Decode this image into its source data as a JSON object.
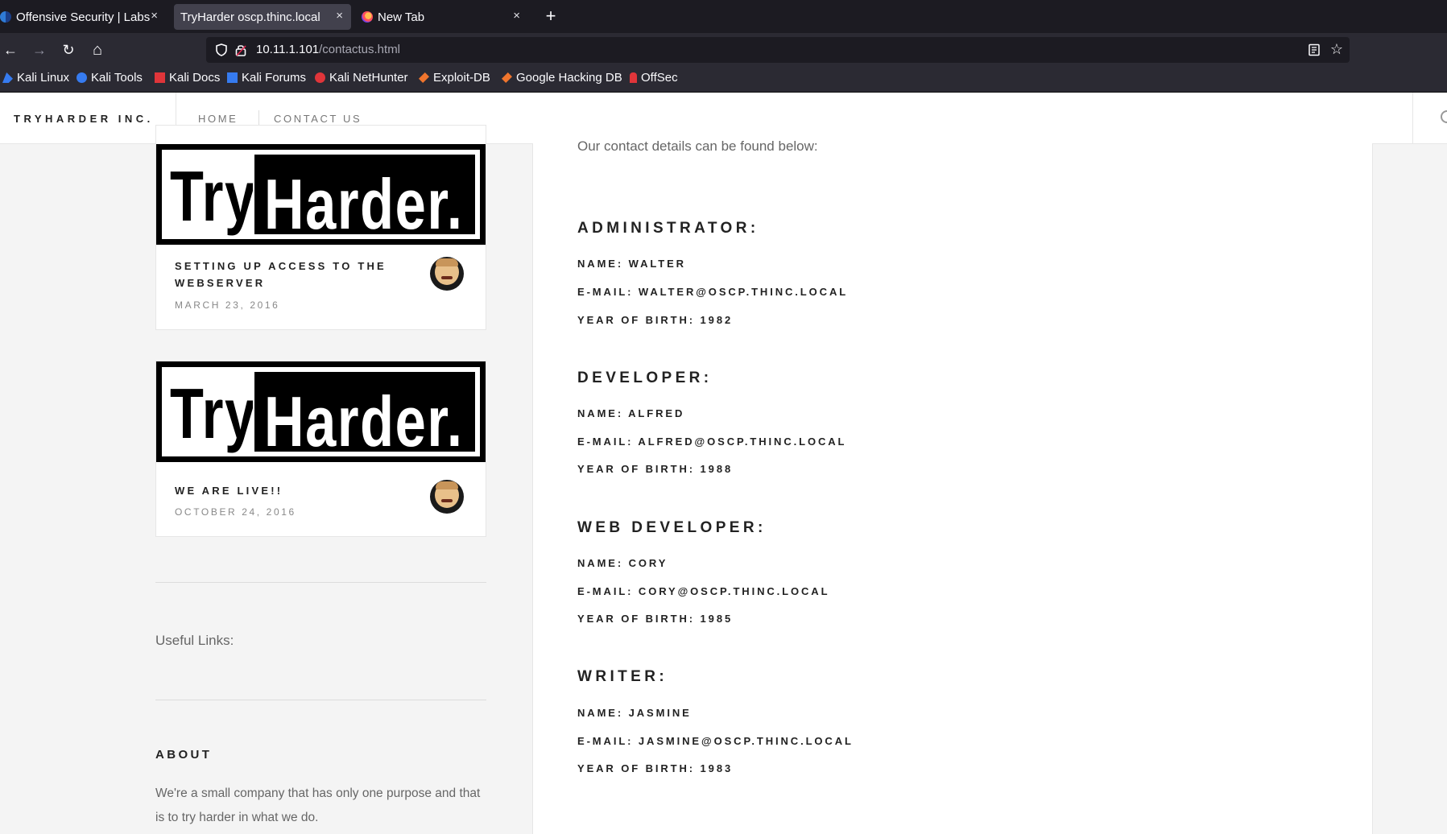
{
  "browser": {
    "tabs": [
      {
        "title": "Offensive Security | Labs",
        "active": false
      },
      {
        "title": "TryHarder oscp.thinc.local",
        "active": true
      },
      {
        "title": "New Tab",
        "active": false
      }
    ],
    "close_glyph": "×",
    "new_tab_glyph": "+",
    "url_host": "10.11.1.101",
    "url_path": "/contactus.html",
    "bookmarks": [
      "Kali Linux",
      "Kali Tools",
      "Kali Docs",
      "Kali Forums",
      "Kali NetHunter",
      "Exploit-DB",
      "Google Hacking DB",
      "OffSec"
    ],
    "icons": {
      "back": "←",
      "forward": "→",
      "reload": "↻",
      "home": "⌂",
      "star": "☆"
    }
  },
  "site": {
    "brand": "TRYHARDER INC.",
    "nav": [
      "HOME",
      "CONTACT US"
    ]
  },
  "sidebar": {
    "logo": {
      "try": "Try",
      "harder": "Harder."
    },
    "posts": [
      {
        "title": "SETTING UP ACCESS TO THE WEBSERVER",
        "date": "MARCH 23, 2016"
      },
      {
        "title": "WE ARE LIVE!!",
        "date": "OCTOBER 24, 2016"
      }
    ],
    "useful_links": "Useful Links:",
    "about_heading": "ABOUT",
    "about_text": "We're a small company that has only one purpose and that is to try harder in what we do."
  },
  "content": {
    "intro": "Our contact details can be found below:",
    "contacts": [
      {
        "role": "ADMINISTRATOR:",
        "name": "NAME: WALTER",
        "email": "E-MAIL: WALTER@OSCP.THINC.LOCAL",
        "birth": "YEAR OF BIRTH: 1982"
      },
      {
        "role": "DEVELOPER:",
        "name": "NAME: ALFRED",
        "email": "E-MAIL: ALFRED@OSCP.THINC.LOCAL",
        "birth": "YEAR OF BIRTH: 1988"
      },
      {
        "role": "WEB DEVELOPER:",
        "name": "NAME: CORY",
        "email": "E-MAIL: CORY@OSCP.THINC.LOCAL",
        "birth": "YEAR OF BIRTH: 1985"
      },
      {
        "role": "WRITER:",
        "name": "NAME: JASMINE",
        "email": "E-MAIL: JASMINE@OSCP.THINC.LOCAL",
        "birth": "YEAR OF BIRTH: 1983"
      }
    ]
  },
  "colors": {
    "chrome_dark": "#1c1b22",
    "chrome": "#2b2a33",
    "active_tab": "#42414d",
    "page_bg": "#f4f4f4"
  }
}
